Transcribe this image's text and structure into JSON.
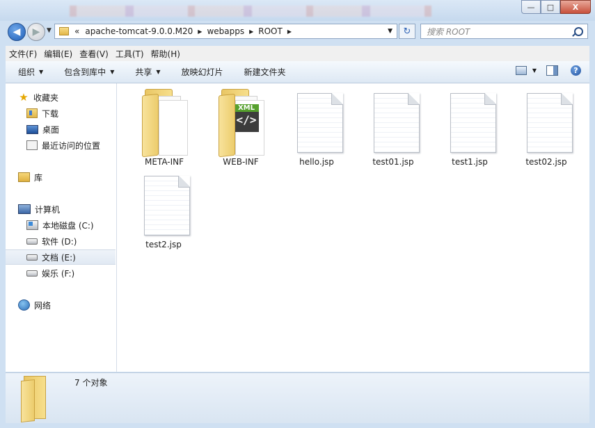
{
  "window": {
    "controls": {
      "minimize": "—",
      "maximize": "□",
      "close": "X"
    }
  },
  "address": {
    "overflow": "«",
    "parts": [
      "apache-tomcat-9.0.0.M20",
      "webapps",
      "ROOT"
    ],
    "search_placeholder": "搜索 ROOT"
  },
  "menu": [
    "文件(F)",
    "编辑(E)",
    "查看(V)",
    "工具(T)",
    "帮助(H)"
  ],
  "commands": {
    "organize": "组织",
    "include_in_library": "包含到库中",
    "share": "共享",
    "slideshow": "放映幻灯片",
    "new_folder": "新建文件夹",
    "help": "?"
  },
  "nav": {
    "favorites": "收藏夹",
    "downloads": "下载",
    "desktop": "桌面",
    "recent": "最近访问的位置",
    "libraries": "库",
    "computer": "计算机",
    "drive_c": "本地磁盘 (C:)",
    "drive_d": "软件 (D:)",
    "drive_e": "文档 (E:)",
    "drive_f": "娱乐 (F:)",
    "network": "网络"
  },
  "files": [
    {
      "name": "META-INF",
      "type": "folder"
    },
    {
      "name": "WEB-INF",
      "type": "folder-xml",
      "badge": "XML",
      "code": "</>"
    },
    {
      "name": "hello.jsp",
      "type": "file"
    },
    {
      "name": "test01.jsp",
      "type": "file"
    },
    {
      "name": "test1.jsp",
      "type": "file"
    },
    {
      "name": "test02.jsp",
      "type": "file"
    },
    {
      "name": "test2.jsp",
      "type": "file"
    }
  ],
  "details": {
    "count": "7 个对象"
  }
}
